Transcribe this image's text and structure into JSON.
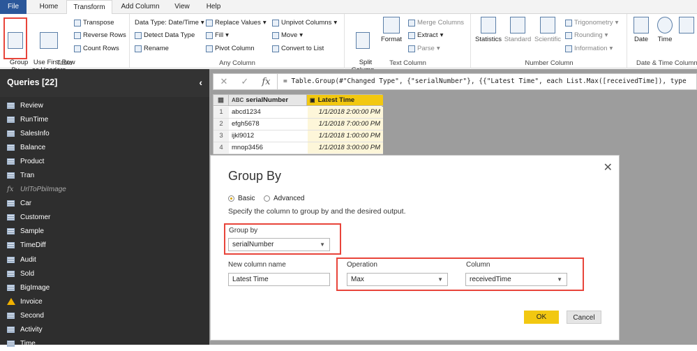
{
  "tabs": {
    "file": "File",
    "home": "Home",
    "transform": "Transform",
    "add_column": "Add Column",
    "view": "View",
    "help": "Help"
  },
  "ribbon": {
    "table": {
      "group_by": "Group\nBy",
      "use_first_row": "Use First Row\nas Headers",
      "transpose": "Transpose",
      "reverse_rows": "Reverse Rows",
      "count_rows": "Count Rows",
      "label": "Table"
    },
    "any_column": {
      "data_type": "Data Type: Date/Time",
      "detect": "Detect Data Type",
      "rename": "Rename",
      "replace": "Replace Values",
      "fill": "Fill",
      "pivot": "Pivot Column",
      "unpivot": "Unpivot Columns",
      "move": "Move",
      "convert": "Convert to List",
      "label": "Any Column"
    },
    "text_column": {
      "split": "Split\nColumn",
      "format": "Format",
      "merge": "Merge Columns",
      "extract": "Extract",
      "parse": "Parse",
      "label": "Text Column"
    },
    "number_column": {
      "statistics": "Statistics",
      "standard": "Standard",
      "scientific": "Scientific",
      "trig": "Trigonometry",
      "rounding": "Rounding",
      "information": "Information",
      "label": "Number Column"
    },
    "datetime": {
      "date": "Date",
      "time": "Time",
      "label": "Date & Time Column"
    }
  },
  "queries": {
    "header": "Queries [22]",
    "items": [
      {
        "name": "Review",
        "kind": "table"
      },
      {
        "name": "RunTime",
        "kind": "table"
      },
      {
        "name": "SalesInfo",
        "kind": "table"
      },
      {
        "name": "Balance",
        "kind": "table"
      },
      {
        "name": "Product",
        "kind": "table"
      },
      {
        "name": "Tran",
        "kind": "table"
      },
      {
        "name": "UrlToPbiImage",
        "kind": "fx"
      },
      {
        "name": "Car",
        "kind": "table"
      },
      {
        "name": "Customer",
        "kind": "table"
      },
      {
        "name": "Sample",
        "kind": "table"
      },
      {
        "name": "TimeDiff",
        "kind": "table"
      },
      {
        "name": "Audit",
        "kind": "table"
      },
      {
        "name": "Sold",
        "kind": "table"
      },
      {
        "name": "BigImage",
        "kind": "table"
      },
      {
        "name": "Invoice",
        "kind": "warn"
      },
      {
        "name": "Second",
        "kind": "table"
      },
      {
        "name": "Activity",
        "kind": "table"
      },
      {
        "name": "Time",
        "kind": "table"
      }
    ]
  },
  "formula": "= Table.Group(#\"Changed Type\", {\"serialNumber\"}, {{\"Latest Time\", each List.Max([receivedTime]), type",
  "grid": {
    "col1": "serialNumber",
    "col2": "Latest Time",
    "col1_type": "ABC",
    "rows": [
      {
        "n": "1",
        "s": "abcd1234",
        "t": "1/1/2018 2:00:00 PM"
      },
      {
        "n": "2",
        "s": "efgh5678",
        "t": "1/1/2018 7:00:00 PM"
      },
      {
        "n": "3",
        "s": "ijkl9012",
        "t": "1/1/2018 1:00:00 PM"
      },
      {
        "n": "4",
        "s": "mnop3456",
        "t": "1/1/2018 3:00:00 PM"
      }
    ]
  },
  "dialog": {
    "title": "Group By",
    "basic": "Basic",
    "advanced": "Advanced",
    "instruction": "Specify the column to group by and the desired output.",
    "group_by_label": "Group by",
    "group_by_value": "serialNumber",
    "new_col_label": "New column name",
    "new_col_value": "Latest Time",
    "operation_label": "Operation",
    "operation_value": "Max",
    "column_label": "Column",
    "column_value": "receivedTime",
    "ok": "OK",
    "cancel": "Cancel"
  },
  "colors": {
    "accent": "#f2c811",
    "highlight": "#e8443a",
    "file_tab": "#2b579a",
    "panel": "#2e2e2e"
  }
}
